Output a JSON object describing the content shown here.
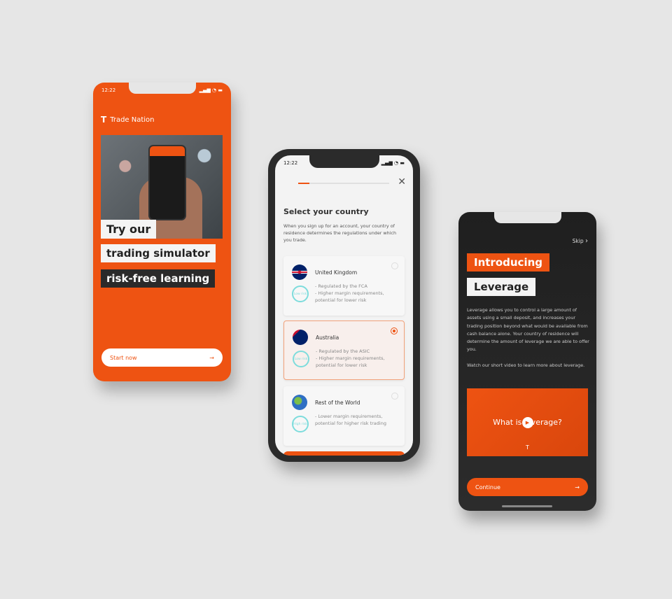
{
  "phone1": {
    "time": "12:22",
    "signal": "▂▄▆ ◔ ▬",
    "brand": "Trade Nation",
    "lines": [
      "Try our",
      "trading simulator",
      "risk-free learning"
    ],
    "cta": "Start now",
    "cta_icon": "arrow-right-icon"
  },
  "phone2": {
    "time": "12:22",
    "signal": "▂▄▆ ◔ ▬",
    "progress_percent": 12,
    "title": "Select your country",
    "intro": "When you sign up for an account, your country of residence determines the regulations under which you trade.",
    "countries": [
      {
        "name": "United Kingdom",
        "badge": "Low risk",
        "bullets": [
          "- Regulated by the FCA",
          "- Higher margin requirements, potential for lower risk"
        ],
        "selected": false
      },
      {
        "name": "Australia",
        "badge": "Low risk",
        "bullets": [
          "- Regulated by the ASIC",
          "- Higher margin requirements, potential for lower risk"
        ],
        "selected": true
      },
      {
        "name": "Rest of the World",
        "badge": "High risk",
        "bullets": [
          "- Lower margin requirements, potential for higher risk trading"
        ],
        "selected": false
      }
    ]
  },
  "phone3": {
    "skip": "Skip",
    "title1": "Introducing",
    "title2": "Leverage",
    "body": "Leverage allows you to control a large amount of assets using a small deposit, and increases your trading position beyond what would be available from cash balance alone. Your country of residence will determine the amount of leverage we are able to offer you.",
    "body2": "Watch our short video to learn more about leverage.",
    "video_title": "What is leverage?",
    "cta": "Continue"
  },
  "colors": {
    "accent": "#ee5312",
    "dark": "#242424",
    "background": "#e6e6e6"
  }
}
